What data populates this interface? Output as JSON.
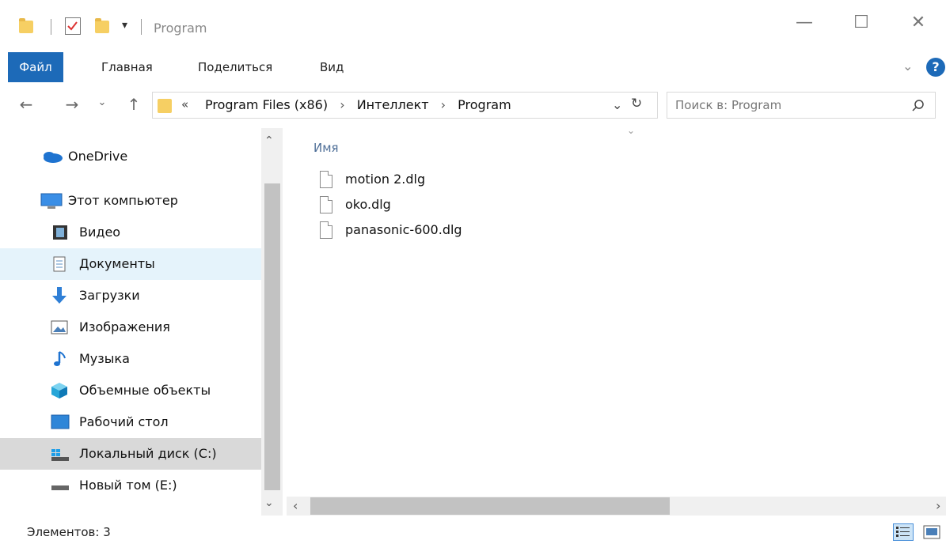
{
  "window": {
    "title": "Program",
    "quick_access_dropdown": "▾",
    "minimize": "—",
    "maximize": "☐",
    "close": "✕"
  },
  "ribbon": {
    "tabs": [
      "Файл",
      "Главная",
      "Поделиться",
      "Вид"
    ],
    "expand_chevron": "⌄",
    "help": "?"
  },
  "address": {
    "overflow": "«",
    "crumbs": [
      "Program Files (x86)",
      "Интеллект",
      "Program"
    ],
    "separator": "›",
    "dropdown": "⌄",
    "refresh": "↻",
    "search_placeholder": "Поиск в: Program"
  },
  "sidebar": {
    "items": [
      {
        "label": "OneDrive",
        "icon": "onedrive-cloud-icon",
        "indent": 0
      },
      {
        "label": "Этот компьютер",
        "icon": "computer-icon",
        "indent": 0
      },
      {
        "label": "Видео",
        "icon": "video-icon",
        "indent": 1
      },
      {
        "label": "Документы",
        "icon": "documents-icon",
        "indent": 1,
        "state": "hover"
      },
      {
        "label": "Загрузки",
        "icon": "downloads-icon",
        "indent": 1
      },
      {
        "label": "Изображения",
        "icon": "pictures-icon",
        "indent": 1
      },
      {
        "label": "Музыка",
        "icon": "music-icon",
        "indent": 1
      },
      {
        "label": "Объемные объекты",
        "icon": "3d-objects-icon",
        "indent": 1
      },
      {
        "label": "Рабочий стол",
        "icon": "desktop-icon",
        "indent": 1
      },
      {
        "label": "Локальный диск (C:)",
        "icon": "local-disk-icon",
        "indent": 1,
        "state": "selected"
      },
      {
        "label": "Новый том (E:)",
        "icon": "drive-icon",
        "indent": 1
      }
    ]
  },
  "content": {
    "column_header": "Имя",
    "files": [
      "motion 2.dlg",
      "oko.dlg",
      "panasonic-600.dlg"
    ]
  },
  "status": {
    "items_count": "Элементов: 3"
  },
  "colors": {
    "accent": "#1d6ab8",
    "hover_row": "#e5f3fb",
    "selected_row": "#d9d9d9",
    "folder_yellow": "#f6cf63"
  }
}
